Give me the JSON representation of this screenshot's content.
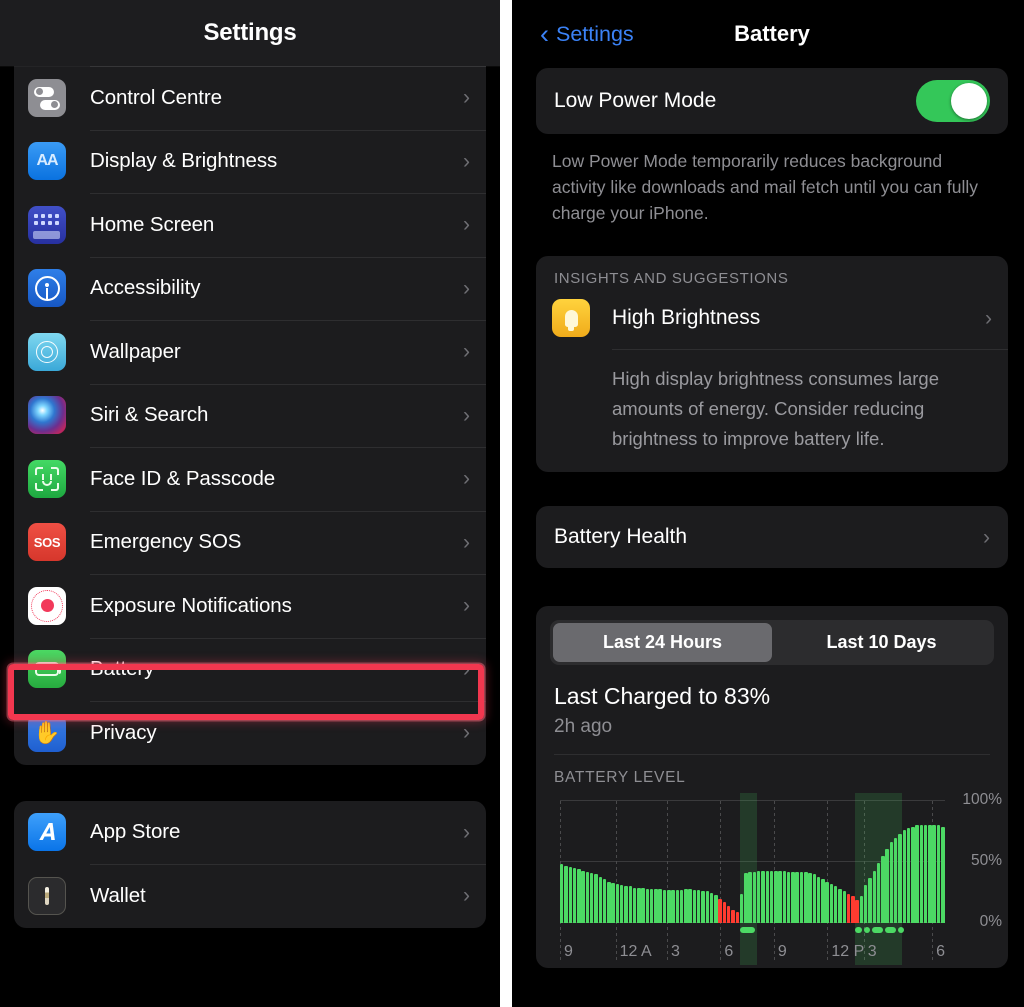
{
  "left": {
    "nav_title": "Settings",
    "groups": [
      {
        "name": "settings-group-primary",
        "rows": [
          {
            "label": "",
            "icon": "partial-icon",
            "partial": true
          },
          {
            "label": "Control Centre",
            "icon": "control-centre-icon"
          },
          {
            "label": "Display & Brightness",
            "icon": "display-brightness-icon"
          },
          {
            "label": "Home Screen",
            "icon": "home-screen-icon"
          },
          {
            "label": "Accessibility",
            "icon": "accessibility-icon"
          },
          {
            "label": "Wallpaper",
            "icon": "wallpaper-icon"
          },
          {
            "label": "Siri & Search",
            "icon": "siri-search-icon"
          },
          {
            "label": "Face ID & Passcode",
            "icon": "face-id-icon"
          },
          {
            "label": "Emergency SOS",
            "icon": "emergency-sos-icon"
          },
          {
            "label": "Exposure Notifications",
            "icon": "exposure-notifications-icon"
          },
          {
            "label": "Battery",
            "icon": "battery-icon"
          },
          {
            "label": "Privacy",
            "icon": "privacy-icon"
          }
        ]
      },
      {
        "name": "settings-group-store",
        "rows": [
          {
            "label": "App Store",
            "icon": "app-store-icon"
          },
          {
            "label": "Wallet",
            "icon": "wallet-icon"
          }
        ]
      }
    ],
    "chevron": "›",
    "icon_text": {
      "display_brightness": "AA",
      "emergency_sos": "SOS",
      "app_store": "𝑨",
      "privacy_hand": "✋"
    }
  },
  "right": {
    "back_label": "Settings",
    "back_chevron": "‹",
    "nav_title": "Battery",
    "low_power_mode": {
      "label": "Low Power Mode",
      "enabled": true,
      "footnote": "Low Power Mode temporarily reduces background activity like downloads and mail fetch until you can fully charge your iPhone."
    },
    "insights": {
      "section_header": "INSIGHTS AND SUGGESTIONS",
      "item_title": "High Brightness",
      "item_icon": "lightbulb-icon",
      "item_body": "High display brightness consumes large amounts of energy. Consider reducing brightness to improve battery life.",
      "chevron": "›"
    },
    "battery_health": {
      "label": "Battery Health",
      "chevron": "›"
    },
    "usage": {
      "segments": [
        {
          "label": "Last 24 Hours",
          "active": true
        },
        {
          "label": "Last 10 Days",
          "active": false
        }
      ],
      "charged_title": "Last Charged to 83%",
      "charged_sub": "2h ago",
      "chart_label": "BATTERY LEVEL"
    }
  },
  "colors": {
    "highlight_red": "#f2374f",
    "toggle_green": "#34c759",
    "bar_green": "#4cd964",
    "bar_red": "#ff3b30",
    "accent_blue": "#3b82f6",
    "card_bg": "#1c1c1e",
    "secondary_text": "#8e8e93"
  },
  "chart_data": {
    "type": "bar",
    "title": "BATTERY LEVEL",
    "xlabel": "",
    "ylabel": "",
    "ylim": [
      0,
      100
    ],
    "ytick_labels": [
      "0%",
      "50%",
      "100%"
    ],
    "yticks": [
      0,
      50,
      100
    ],
    "grid": true,
    "legend": "none",
    "xtick_labels": [
      "9",
      "12 A",
      "3",
      "6",
      "9",
      "12 P",
      "3",
      "6"
    ],
    "xtick_positions": [
      0,
      13.0,
      25.0,
      37.5,
      50.0,
      62.5,
      71.0,
      87.0
    ],
    "series": [
      {
        "name": "Battery level (%)",
        "color": "#4cd964",
        "low_color": "#ff3b30",
        "values": [
          48,
          47,
          46,
          45,
          44,
          43,
          42,
          41,
          40,
          38,
          36,
          34,
          33,
          32,
          31,
          30,
          30,
          29,
          29,
          29,
          28,
          28,
          28,
          28,
          27,
          27,
          27,
          27,
          27,
          28,
          28,
          27,
          27,
          26,
          26,
          25,
          23,
          20,
          17,
          14,
          11,
          9,
          24,
          41,
          42,
          42,
          43,
          43,
          43,
          43,
          43,
          43,
          43,
          42,
          42,
          42,
          42,
          42,
          41,
          40,
          38,
          36,
          34,
          32,
          30,
          28,
          26,
          24,
          22,
          19,
          22,
          31,
          37,
          43,
          49,
          55,
          61,
          66,
          70,
          73,
          76,
          78,
          79,
          80,
          80,
          80,
          80,
          80,
          80,
          79
        ],
        "low_flags": [
          false,
          false,
          false,
          false,
          false,
          false,
          false,
          false,
          false,
          false,
          false,
          false,
          false,
          false,
          false,
          false,
          false,
          false,
          false,
          false,
          false,
          false,
          false,
          false,
          false,
          false,
          false,
          false,
          false,
          false,
          false,
          false,
          false,
          false,
          false,
          false,
          false,
          true,
          true,
          true,
          true,
          true,
          false,
          false,
          false,
          false,
          false,
          false,
          false,
          false,
          false,
          false,
          false,
          false,
          false,
          false,
          false,
          false,
          false,
          false,
          false,
          false,
          false,
          false,
          false,
          false,
          false,
          true,
          true,
          true,
          false,
          false,
          false,
          false,
          false,
          false,
          false,
          false,
          false,
          false,
          false,
          false,
          false,
          false,
          false,
          false,
          false,
          false,
          false,
          false
        ]
      }
    ],
    "charging_bands": [
      {
        "start_index": 42,
        "end_index": 45
      },
      {
        "start_index": 69,
        "end_index": 71
      },
      {
        "start_index": 72,
        "end_index": 74
      },
      {
        "start_index": 75,
        "end_index": 76
      },
      {
        "start_index": 77,
        "end_index": 79
      }
    ],
    "charging_markers": [
      {
        "start_index": 42,
        "end_index": 45
      },
      {
        "start_index": 69,
        "end_index": 70
      },
      {
        "start_index": 71,
        "end_index": 72
      },
      {
        "start_index": 73,
        "end_index": 75
      },
      {
        "start_index": 76,
        "end_index": 78
      },
      {
        "start_index": 79,
        "end_index": 80
      }
    ],
    "n_bars": 90
  }
}
